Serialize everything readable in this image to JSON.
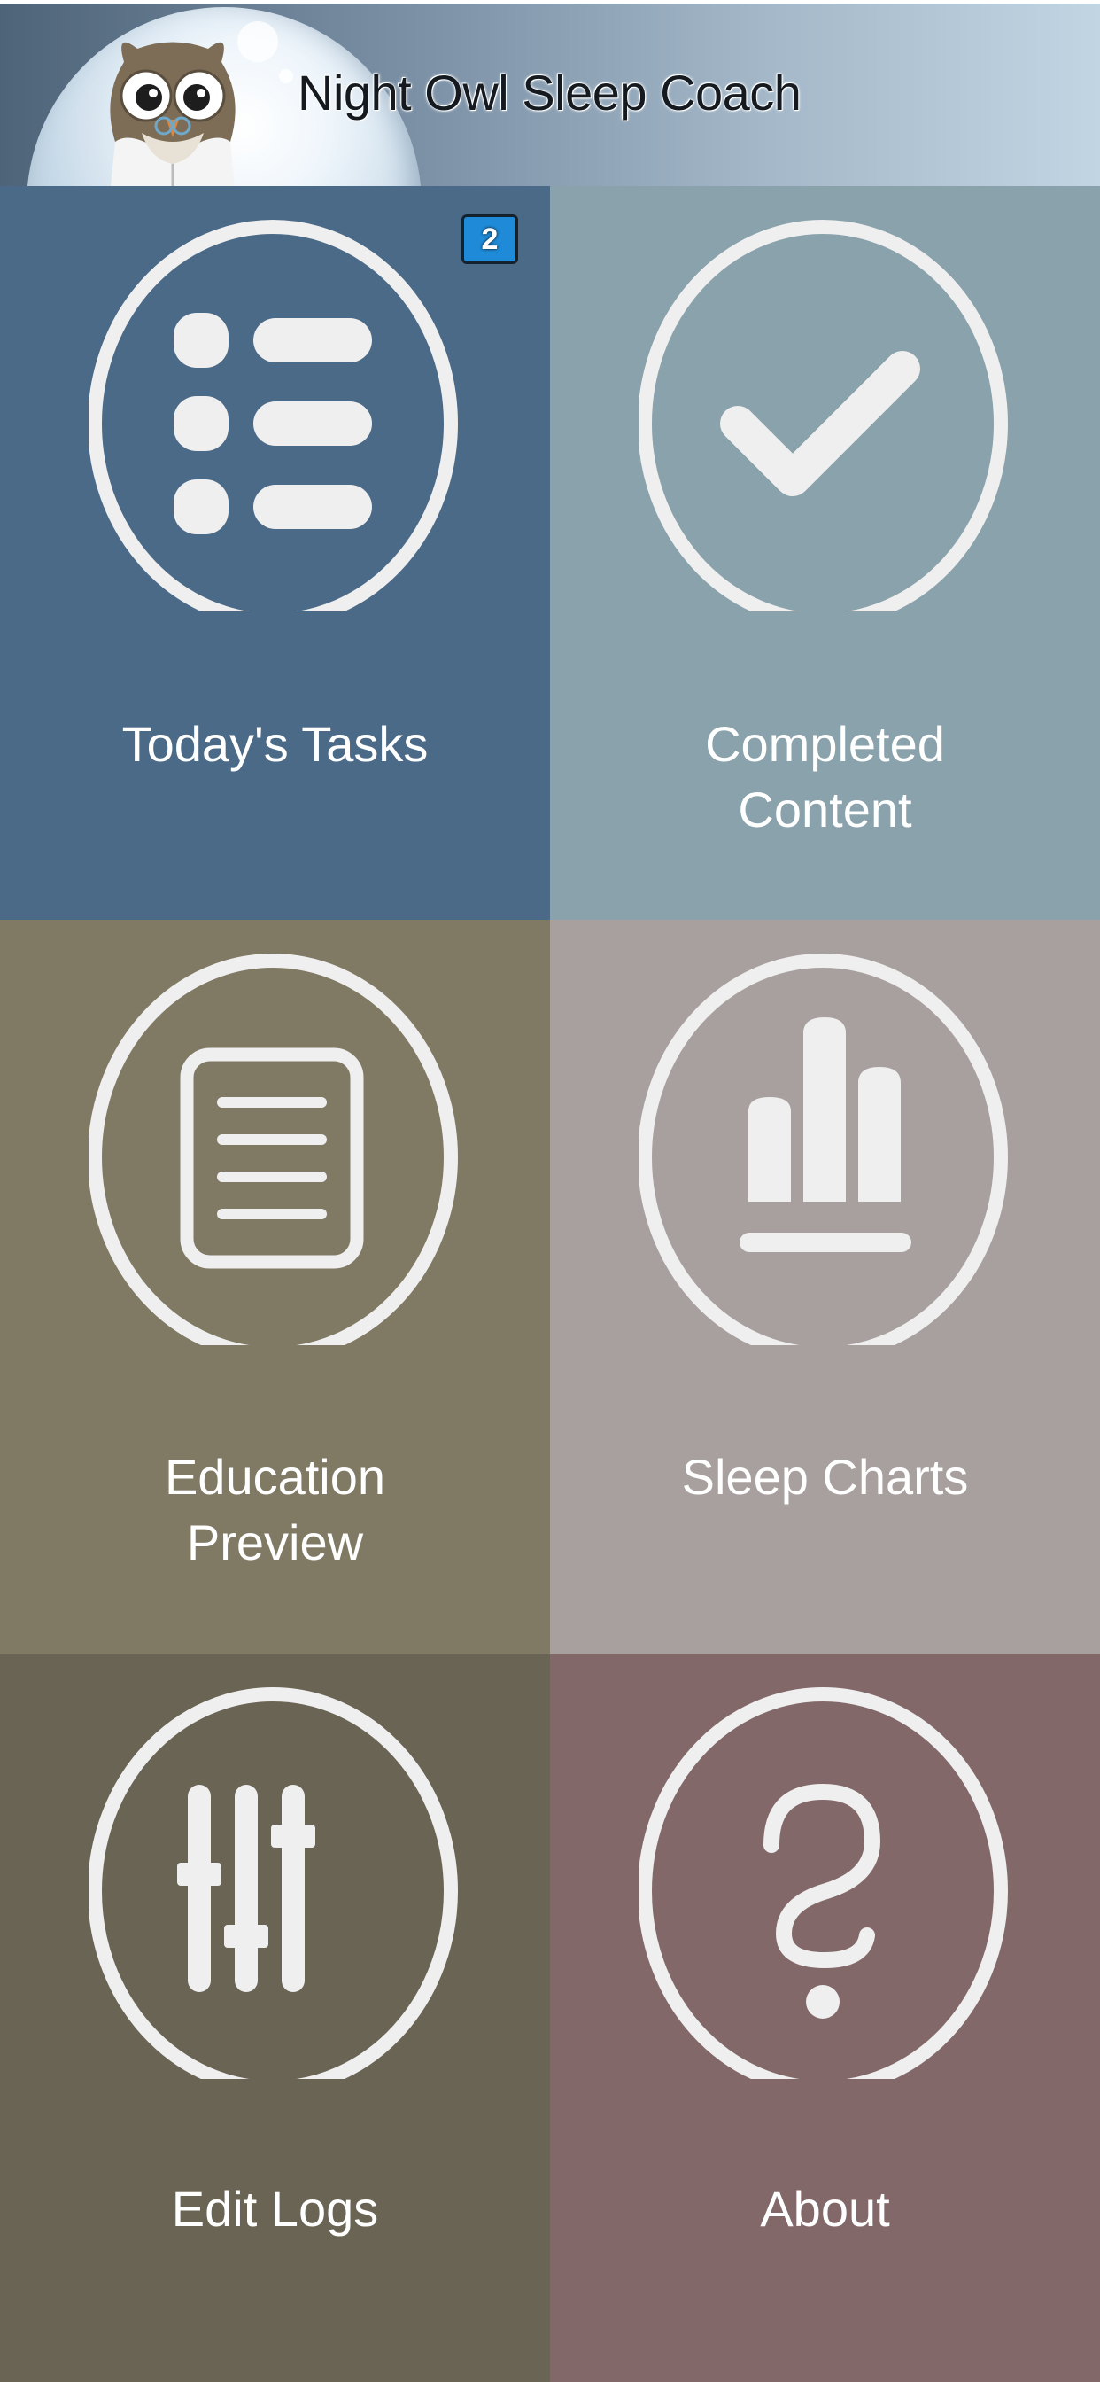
{
  "header": {
    "title": "Night Owl Sleep Coach"
  },
  "tiles": [
    {
      "id": "todays-tasks",
      "label_line1": "Today's Tasks",
      "label_line2": "",
      "badge": "2",
      "color": "#4b6a88",
      "icon": "list-icon"
    },
    {
      "id": "completed-content",
      "label_line1": "Completed",
      "label_line2": "Content",
      "color": "#89a2ab",
      "icon": "checkmark-icon"
    },
    {
      "id": "education-preview",
      "label_line1": "Education",
      "label_line2": "Preview",
      "color": "#807a65",
      "icon": "document-icon"
    },
    {
      "id": "sleep-charts",
      "label_line1": "Sleep Charts",
      "label_line2": "",
      "color": "#a8a09e",
      "icon": "bar-chart-icon"
    },
    {
      "id": "edit-logs",
      "label_line1": "Edit Logs",
      "label_line2": "",
      "color": "#6a6454",
      "icon": "sliders-icon"
    },
    {
      "id": "about",
      "label_line1": "About",
      "label_line2": "",
      "color": "#836869",
      "icon": "question-icon"
    }
  ]
}
